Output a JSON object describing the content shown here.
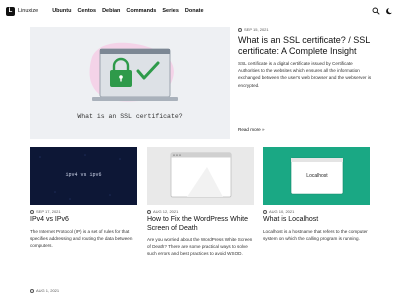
{
  "header": {
    "logo_text": "Linuxize",
    "nav": [
      "Ubuntu",
      "Centos",
      "Debian",
      "Commands",
      "Series",
      "Donate"
    ]
  },
  "featured": {
    "image_caption": "What is an SSL certificate?",
    "date": "SEP 15, 2021",
    "title": "What is an SSL certificate? / SSL certificate: A Complete Insight",
    "excerpt": "SSL certificate is a digital certificate issued by Certificate Authorities to the websites which ensures all the information exchanged between the user's web browser and the webserver is encrypted.",
    "read_more": "Read more »"
  },
  "cards": [
    {
      "image_text": "ipv4 vs ipv6",
      "date": "SEP 17, 2021",
      "title": "IPv4 vs IPv6",
      "excerpt": "The Internet Protocol (IP) is a set of rules for that specifies addressing and routing the data between computers."
    },
    {
      "image_text": "",
      "date": "AUG 12, 2021",
      "title": "How to Fix the WordPress White Screen of Death",
      "excerpt": "Are you worried about the WordPress White Screen of Death? There are some practical ways to solve such errors and best practices to avoid WSOD."
    },
    {
      "image_text": "Localhost",
      "date": "AUG 10, 2021",
      "title": "What is Localhost",
      "excerpt": "Localhost is a hostname that refers to the computer system on which the calling program is running."
    }
  ],
  "bottom_date": "AUG 1, 2021",
  "colors": {
    "card1_bg": "#0d1736",
    "card2_bg": "#e9e9e9",
    "card3_bg": "#1aa884",
    "lock_green": "#2e9a4a",
    "blob_pink": "#f4d3e8"
  }
}
